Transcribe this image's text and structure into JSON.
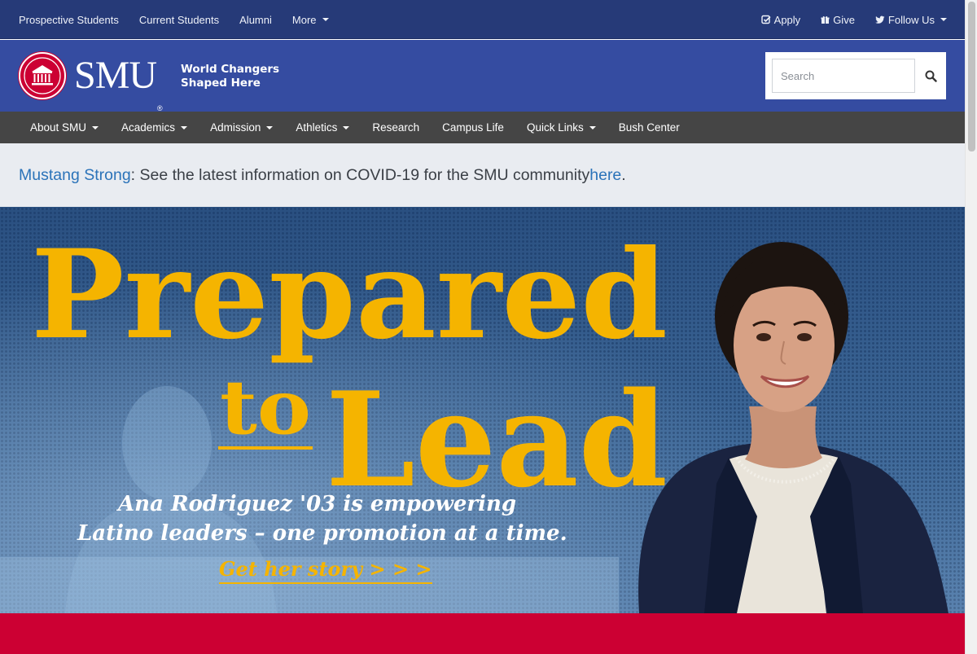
{
  "utility_nav": {
    "left": [
      "Prospective Students",
      "Current Students",
      "Alumni",
      "More"
    ],
    "right": {
      "apply": "Apply",
      "give": "Give",
      "follow": "Follow Us"
    }
  },
  "brand": {
    "wordmark": "SMU",
    "reg_mark": "®",
    "tagline_line1": "World Changers",
    "tagline_line2": "Shaped Here"
  },
  "search": {
    "placeholder": "Search"
  },
  "main_nav": [
    "About SMU",
    "Academics",
    "Admission",
    "Athletics",
    "Research",
    "Campus Life",
    "Quick Links",
    "Bush Center"
  ],
  "alert": {
    "link_text": "Mustang Strong",
    "message": ": See the latest information on COVID-19 for the SMU community ",
    "here_link": "here",
    "period": "."
  },
  "hero": {
    "title_line1": "Prepared",
    "title_to": "to",
    "title_line2": "Lead",
    "subtitle_line1": "Ana Rodriguez '03 is empowering",
    "subtitle_line2": "Latino leaders – one promotion at a time.",
    "cta": "Get her story > > >"
  },
  "colors": {
    "utility_bar": "#263a78",
    "brand_bar": "#354ca1",
    "main_nav": "#454545",
    "alert_bg": "#e9ecf1",
    "link": "#2b73b9",
    "hero_gold": "#f5b400",
    "smu_red": "#cc0033"
  },
  "icons": {
    "apply": "check-square-icon",
    "give": "gift-icon",
    "follow": "twitter-icon",
    "search": "search-icon",
    "seal": "smu-seal-icon"
  }
}
